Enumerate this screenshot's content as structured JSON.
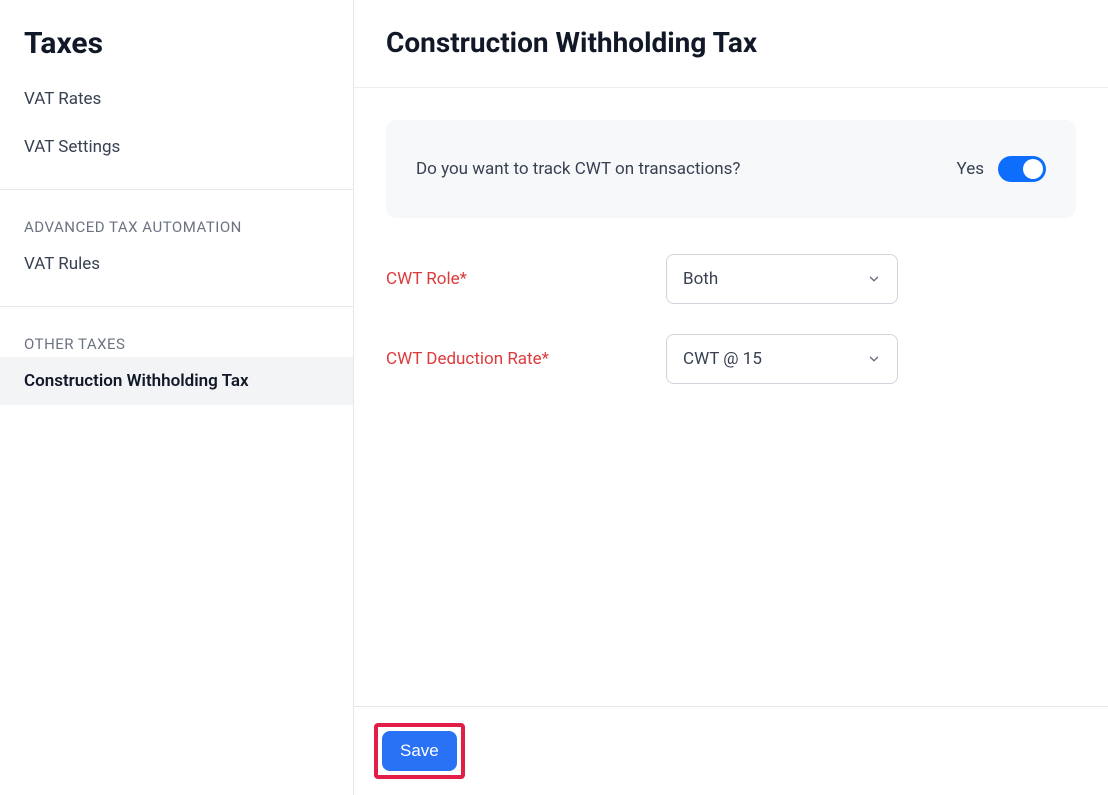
{
  "sidebar": {
    "title": "Taxes",
    "items_top": [
      {
        "label": "VAT Rates"
      },
      {
        "label": "VAT Settings"
      }
    ],
    "section_advanced": {
      "header": "ADVANCED TAX AUTOMATION",
      "items": [
        {
          "label": "VAT Rules"
        }
      ]
    },
    "section_other": {
      "header": "OTHER TAXES",
      "items": [
        {
          "label": "Construction Withholding Tax",
          "active": true
        }
      ]
    }
  },
  "main": {
    "title": "Construction Withholding Tax",
    "toggle": {
      "question": "Do you want to track CWT on transactions?",
      "value_text": "Yes",
      "on": true
    },
    "fields": {
      "role": {
        "label": "CWT Role*",
        "value": "Both"
      },
      "rate": {
        "label": "CWT Deduction Rate*",
        "value": "CWT @ 15"
      }
    },
    "footer": {
      "save_label": "Save"
    }
  }
}
